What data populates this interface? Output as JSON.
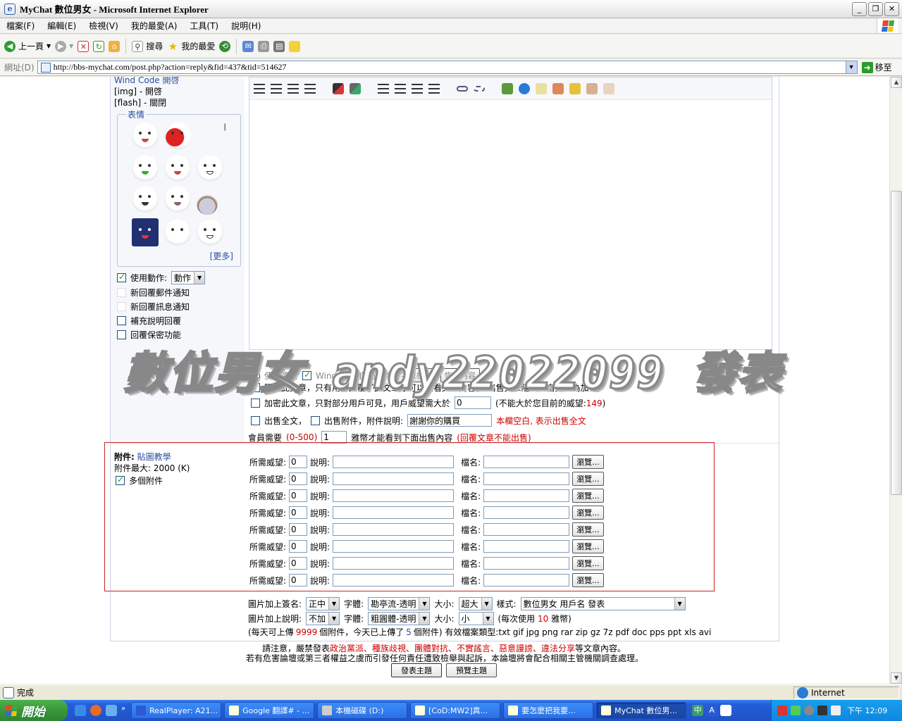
{
  "window": {
    "title": "MyChat 數位男女 - Microsoft Internet Explorer",
    "btn_min": "_",
    "btn_max": "❐",
    "btn_close": "✕"
  },
  "menu": [
    "檔案(F)",
    "編輯(E)",
    "檢視(V)",
    "我的最愛(A)",
    "工具(T)",
    "說明(H)"
  ],
  "toolbar": {
    "back": "上一頁",
    "search": "搜尋",
    "favorites": "我的最愛"
  },
  "address": {
    "label": "網址(D)",
    "url": "http://bbs-mychat.com/post.php?action=reply&fid=437&tid=514627",
    "go": "移至"
  },
  "left": {
    "wind_code": "Wind Code 開啓",
    "img": "[img] - 開啓",
    "flash": "[flash] - 關閉",
    "emot_legend": "表情",
    "more": "[更多]",
    "use_action": "使用動作:",
    "action_value": "動作",
    "opts": [
      "新回覆郵件通知",
      "新回覆訊息通知",
      "補充說明回覆",
      "回覆保密功能"
    ]
  },
  "editor": {
    "watermark": "數位男女 andy22022099 發表"
  },
  "options": {
    "use_sig": "使用簽名",
    "windcode_auto": "WindCode自動轉換",
    "check_len": "字數檢查",
    "restore": "恢復內容",
    "hide": "隱藏此文章，只有用戶回覆了此文章才可以查看文章內容(若出售文章隱藏將自動變為加密)",
    "encrypt": "加密此文章，只對部分用戶可見，用戶威望需大於",
    "encrypt_val": "0",
    "encrypt_note_a": "(不能大於您目前的威望:",
    "encrypt_cur": "149",
    "encrypt_note_b": ")",
    "sell_all": "出售全文，",
    "sell_att": "出售附件，附件說明:",
    "sell_att_val": "謝謝你的購買",
    "sell_note": "本欄空白, 表示出售全文",
    "member_need_a": "會員需要",
    "member_range": "(0-500)",
    "member_val": "1",
    "member_need_b": "雅幣才能看到下面出售內容",
    "member_note": "(回覆文章不能出售)"
  },
  "attach": {
    "label": "附件:",
    "link": "貼圖教學",
    "max": "附件最大: 2000 (K)",
    "multi": "多個附件",
    "need": "所需威望:",
    "need_val": "0",
    "desc": "說明:",
    "fname": "檔名:",
    "browse": "瀏覽...",
    "rows": [
      1,
      2,
      3,
      4,
      5,
      6,
      7,
      8
    ]
  },
  "img_sign": {
    "sig_label": "圖片加上簽名:",
    "sig_pos": "正中",
    "font_label": "字體:",
    "font1": "勘亭流-透明",
    "size_label": "大小:",
    "size1": "超大",
    "style_label": "樣式:",
    "style_val": "數位男女 用戶名 發表",
    "desc_label": "圖片加上說明:",
    "desc_val": "不加",
    "font2": "粗圓體-透明",
    "size2": "小",
    "cost_a": "(每次使用",
    "cost_val": "10",
    "cost_b": "雅幣)",
    "upload_a": "(每天可上傳",
    "upload_max": "9999",
    "upload_b": "個附件，今天已上傳了",
    "upload_done": "5",
    "upload_c": "個附件) 有效檔案類型:txt gif jpg png rar zip gz 7z pdf doc pps ppt xls avi"
  },
  "notice": {
    "a": "請注意，嚴禁發表",
    "red": "政治黨派、種族歧視、團體對抗、不實謠言、惡意謾謗、違法分享",
    "b": "等文章內容。",
    "line2": "若有危害論壇或第三者權益之虞而引發任何責任遭致檢舉與起訴，本論壇將會配合相關主管機關調查處理。",
    "submit": "發表主題",
    "preview": "預覽主題"
  },
  "status": {
    "text": "完成",
    "zone": "Internet"
  },
  "taskbar": {
    "start": "開始",
    "tasks": [
      "RealPlayer: A21...",
      "Google 翻譯# - ...",
      "本機磁碟 (D:)",
      "[CoD:MW2]真...",
      "要怎麼把我要...",
      "MyChat 數位男..."
    ],
    "clock": "下午 12:09"
  },
  "colors": {
    "accent_red": "#cc0000",
    "link_blue": "#2a4fa0",
    "attach_border": "#cc2222"
  }
}
